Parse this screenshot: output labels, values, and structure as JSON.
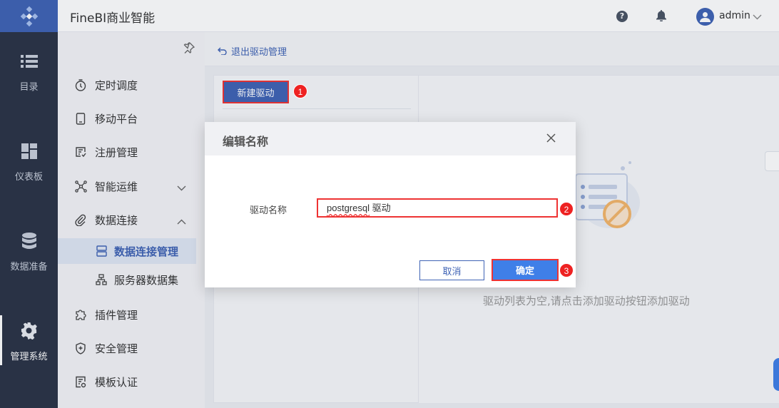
{
  "app": {
    "title": "FineBI商业智能"
  },
  "header": {
    "help_icon": "?",
    "user": "admin"
  },
  "rail": {
    "items": [
      {
        "label": "目录",
        "icon": "list-icon"
      },
      {
        "label": "仪表板",
        "icon": "dashboard-icon"
      },
      {
        "label": "数据准备",
        "icon": "database-icon"
      },
      {
        "label": "管理系统",
        "icon": "gear-icon",
        "active": true
      }
    ]
  },
  "subnav": {
    "items": [
      {
        "label": "定时调度",
        "icon": "timer-icon"
      },
      {
        "label": "移动平台",
        "icon": "mobile-icon"
      },
      {
        "label": "注册管理",
        "icon": "register-icon"
      },
      {
        "label": "智能运维",
        "icon": "ops-icon"
      },
      {
        "label": "数据连接",
        "icon": "link-icon"
      },
      {
        "label": "插件管理",
        "icon": "plugin-icon"
      },
      {
        "label": "安全管理",
        "icon": "shield-icon"
      },
      {
        "label": "模板认证",
        "icon": "template-icon"
      }
    ],
    "sub_items": [
      {
        "label": "数据连接管理",
        "active": true
      },
      {
        "label": "服务器数据集"
      }
    ]
  },
  "content": {
    "back_label": "退出驱动管理",
    "new_driver_label": "新建驱动",
    "empty_text": "驱动列表为空,请点击添加驱动按钮添加驱动"
  },
  "dialog": {
    "title": "编辑名称",
    "field_label": "驱动名称",
    "field_value_word": "postgresql",
    "field_value_rest": " 驱动",
    "cancel_label": "取消",
    "confirm_label": "确定"
  },
  "badges": [
    "1",
    "2",
    "3"
  ],
  "colors": {
    "accent": "#3f63b5",
    "highlight": "#e33333",
    "confirm": "#3f7fe8"
  }
}
